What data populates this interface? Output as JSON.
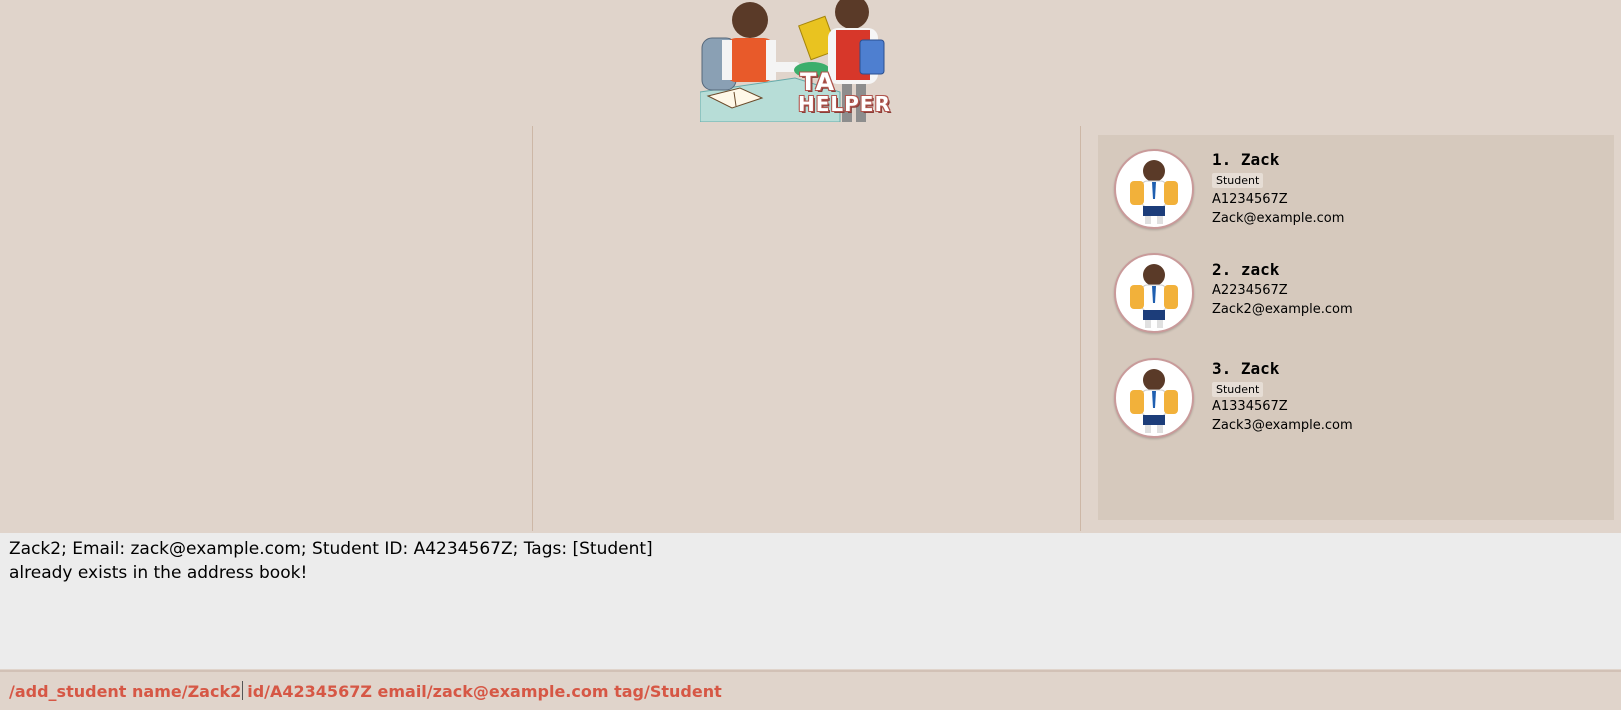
{
  "header": {
    "logo_text_line1": "TA",
    "logo_text_line2": "HELPER"
  },
  "student_list": [
    {
      "index": "1.",
      "name": "Zack",
      "tag": "Student",
      "student_id": "A1234567Z",
      "email": "Zack@example.com"
    },
    {
      "index": "2.",
      "name": "zack",
      "tag": "",
      "student_id": "A2234567Z",
      "email": "Zack2@example.com"
    },
    {
      "index": "3.",
      "name": "Zack",
      "tag": "Student",
      "student_id": "A1334567Z",
      "email": "Zack3@example.com"
    }
  ],
  "result": {
    "line1": "Zack2; Email: zack@example.com; Student ID: A4234567Z; Tags: [Student]",
    "line2": "already exists in the address book!"
  },
  "command": {
    "before_caret": "/add_student name/Zack2",
    "after_caret": "id/A4234567Z email/zack@example.com tag/Student"
  },
  "colors": {
    "background": "#e0d4cb",
    "panel": "#d6c9bd",
    "result_bg": "#ececec",
    "command_text": "#d65745"
  },
  "icons": [
    "logo-illustration",
    "student-avatar-icon"
  ]
}
